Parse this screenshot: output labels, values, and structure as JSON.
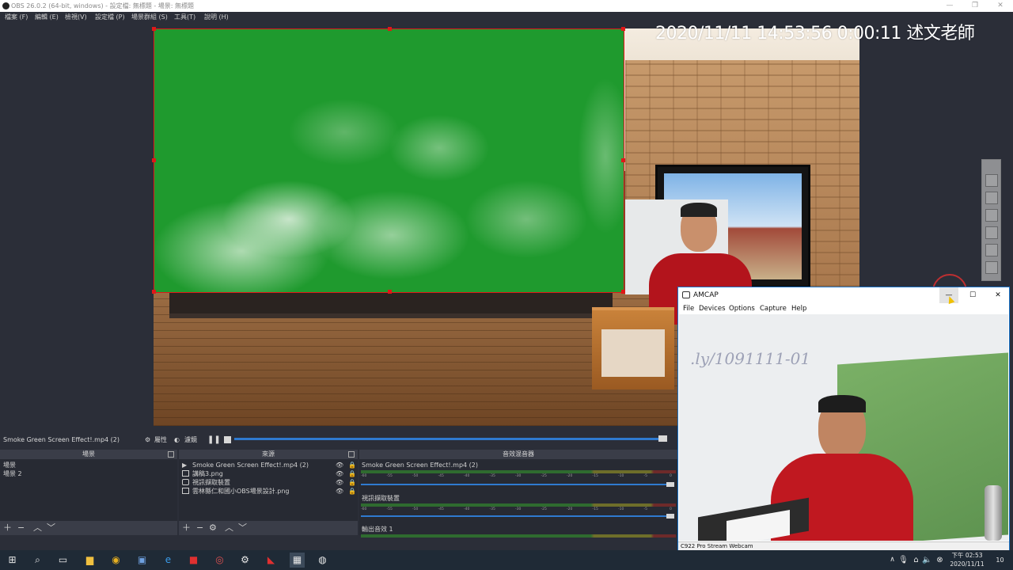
{
  "obs": {
    "window_title": "OBS 26.0.2 (64-bit, windows) - 設定檔: 無標題 - 場景: 無標題",
    "menu": [
      "檔案 (F)",
      "編輯 (E)",
      "檢視(V)",
      "設定檔 (P)",
      "場景群組 (S)",
      "工具(T)",
      "說明 (H)"
    ]
  },
  "preview": {
    "overlay_text": "2020/11/11 14:53:56 0:00:11 述文老師",
    "selection_color": "#e01818",
    "chroma_green": "#1f9a2e"
  },
  "control_strip": {
    "selected_source": "Smoke Green Screen Effect!.mp4 (2)",
    "properties_label": "屬性",
    "filters_label": "濾鏡",
    "pause_icon": "pause-icon",
    "stop_icon": "stop-icon"
  },
  "scenes_dock": {
    "title": "場景",
    "items": [
      "場景",
      "場景 2"
    ]
  },
  "sources_dock": {
    "title": "來源",
    "items": [
      {
        "icon": "play-icon",
        "label": "Smoke Green Screen Effect!.mp4 (2)"
      },
      {
        "icon": "image-icon",
        "label": "講稿3.png"
      },
      {
        "icon": "camera-icon",
        "label": "視訊擷取裝置"
      },
      {
        "icon": "image-icon",
        "label": "雲林縣仁和國小OBS場景設計.png"
      }
    ]
  },
  "mixer_dock": {
    "title": "音效混音器",
    "channels": [
      {
        "name": "Smoke Green Screen Effect!.mp4 (2)"
      },
      {
        "name": "視訊擷取裝置"
      },
      {
        "name": "輸出音效 1"
      }
    ],
    "tick_labels": [
      "-60",
      "-55",
      "-50",
      "-45",
      "-40",
      "-35",
      "-30",
      "-25",
      "-20",
      "-15",
      "-10",
      "-5",
      "0"
    ]
  },
  "amcap": {
    "title": "AMCAP",
    "menu": [
      "File",
      "Devices",
      "Options",
      "Capture",
      "Help"
    ],
    "status": "C922 Pro Stream Webcam",
    "handwriting": ".ly/1091111-01"
  },
  "taskbar": {
    "time": "下午 02:53",
    "date": "2020/11/11",
    "notification_count": "10"
  }
}
